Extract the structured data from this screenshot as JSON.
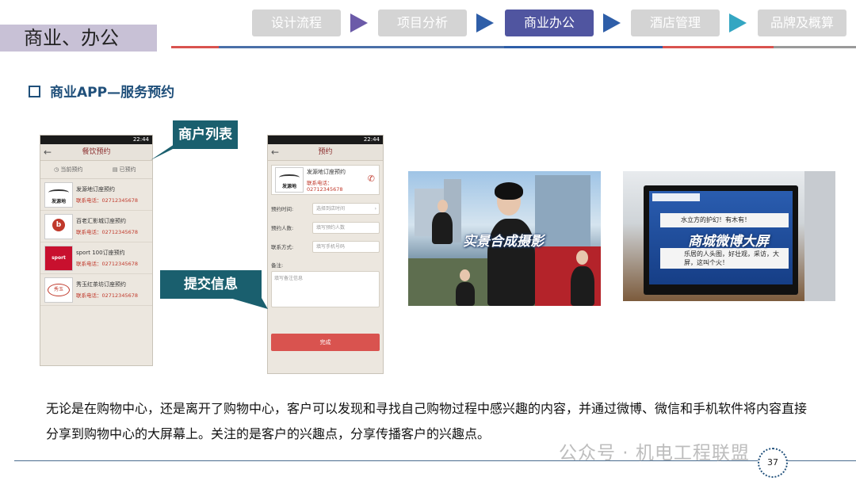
{
  "header": {
    "section_title": "商业、办公",
    "nav_steps": [
      {
        "label": "设计流程",
        "active": false
      },
      {
        "label": "项目分析",
        "active": false
      },
      {
        "label": "商业办公",
        "active": true
      },
      {
        "label": "酒店管理",
        "active": false
      },
      {
        "label": "品牌及概算",
        "active": false
      }
    ],
    "colors": {
      "active": "#5055a0",
      "inactive": "#d4d4d4",
      "arrow_purple": "#6b5aa8",
      "arrow_blue": "#2e5ea8",
      "arrow_teal": "#34a6c2"
    }
  },
  "subtitle": "商业APP—服务预约",
  "phone_list": {
    "status_time": "22:44",
    "title": "餐饮预约",
    "tabs": [
      "当前预约",
      "已预约"
    ],
    "merchants": [
      {
        "name": "发源地订座预约",
        "phone": "联系电话：02712345678",
        "logo": "发源地"
      },
      {
        "name": "百老汇影城订座预约",
        "phone": "联系电话：02712345678",
        "logo": "b"
      },
      {
        "name": "sport 100订座预约",
        "phone": "联系电话：02712345678",
        "logo": "sport"
      },
      {
        "name": "秀玉红茶坊订座预约",
        "phone": "联系电话：02712345678",
        "logo": "秀玉"
      }
    ]
  },
  "phone_booking": {
    "status_time": "22:44",
    "title": "预约",
    "merchant_name": "发源地订座预约",
    "merchant_phone": "联系电话：02712345678",
    "logo": "发源地",
    "fields": [
      {
        "label": "预约时间:",
        "placeholder": "选择到店时间"
      },
      {
        "label": "预约人数:",
        "placeholder": "填写预约人数"
      },
      {
        "label": "联系方式:",
        "placeholder": "填写手机号码"
      }
    ],
    "note_label": "备注:",
    "note_placeholder": "填写备注信息",
    "submit": "完成"
  },
  "callouts": {
    "merchant_list": "商户列表",
    "submit_info": "提交信息"
  },
  "photos": {
    "left_caption": "实景合成摄影",
    "right_caption": "商城微博大屏",
    "screen_lines": [
      "水立方的护幻！有木有！",
      "乐居的人头图，好壮观，采访，大屏，这叫个火！"
    ]
  },
  "paragraph": "无论是在购物中心，还是离开了购物中心，客户可以发现和寻找自己购物过程中感兴趣的内容，并通过微博、微信和手机软件将内容直接分享到购物中心的大屏幕上。关注的是客户的兴趣点，分享传播客户的兴趣点。",
  "page_number": "37",
  "watermark": "公众号 · 机电工程联盟"
}
